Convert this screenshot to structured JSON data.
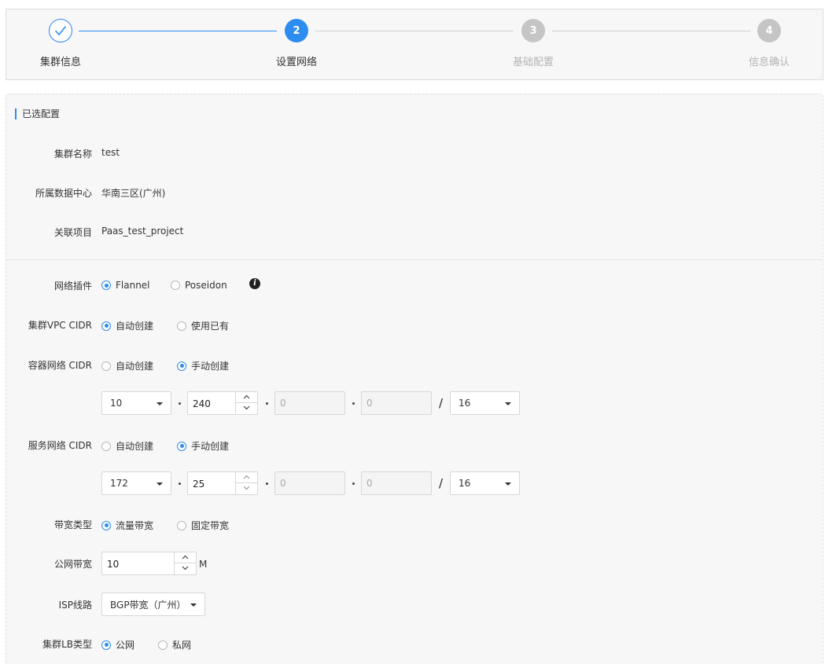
{
  "steps": [
    {
      "label": "集群信息",
      "number": "",
      "state": "done"
    },
    {
      "label": "设置网络",
      "number": "2",
      "state": "active"
    },
    {
      "label": "基础配置",
      "number": "3",
      "state": "pending"
    },
    {
      "label": "信息确认",
      "number": "4",
      "state": "pending"
    }
  ],
  "selected": {
    "title": "已选配置",
    "cluster_name_label": "集群名称",
    "cluster_name": "test",
    "datacenter_label": "所属数据中心",
    "datacenter": "华南三区(广州)",
    "project_label": "关联项目",
    "project": "Paas_test_project"
  },
  "network_plugin": {
    "label": "网络插件",
    "options": [
      "Flannel",
      "Poseidon"
    ],
    "selected": "Flannel",
    "info_icon": "info-icon"
  },
  "vpc_cidr": {
    "label": "集群VPC CIDR",
    "options": [
      "自动创建",
      "使用已有"
    ],
    "selected": "自动创建"
  },
  "container_cidr": {
    "label": "容器网络 CIDR",
    "options": [
      "自动创建",
      "手动创建"
    ],
    "selected": "手动创建",
    "octet1": "10",
    "octet2": "240",
    "octet3": "0",
    "octet4": "0",
    "mask": "16"
  },
  "service_cidr": {
    "label": "服务网络 CIDR",
    "options": [
      "自动创建",
      "手动创建"
    ],
    "selected": "手动创建",
    "octet1": "172",
    "octet2": "25",
    "octet3": "0",
    "octet4": "0",
    "mask": "16"
  },
  "bandwidth_type": {
    "label": "带宽类型",
    "options": [
      "流量带宽",
      "固定带宽"
    ],
    "selected": "流量带宽"
  },
  "public_bandwidth": {
    "label": "公网带宽",
    "value": "10",
    "unit": "M"
  },
  "isp": {
    "label": "ISP线路",
    "value": "BGP带宽（广州）"
  },
  "lb_type": {
    "label": "集群LB类型",
    "options": [
      "公网",
      "私网"
    ],
    "selected": "公网"
  },
  "colors": {
    "accent": "#2d8cf0",
    "pending": "#c5c5c5"
  }
}
